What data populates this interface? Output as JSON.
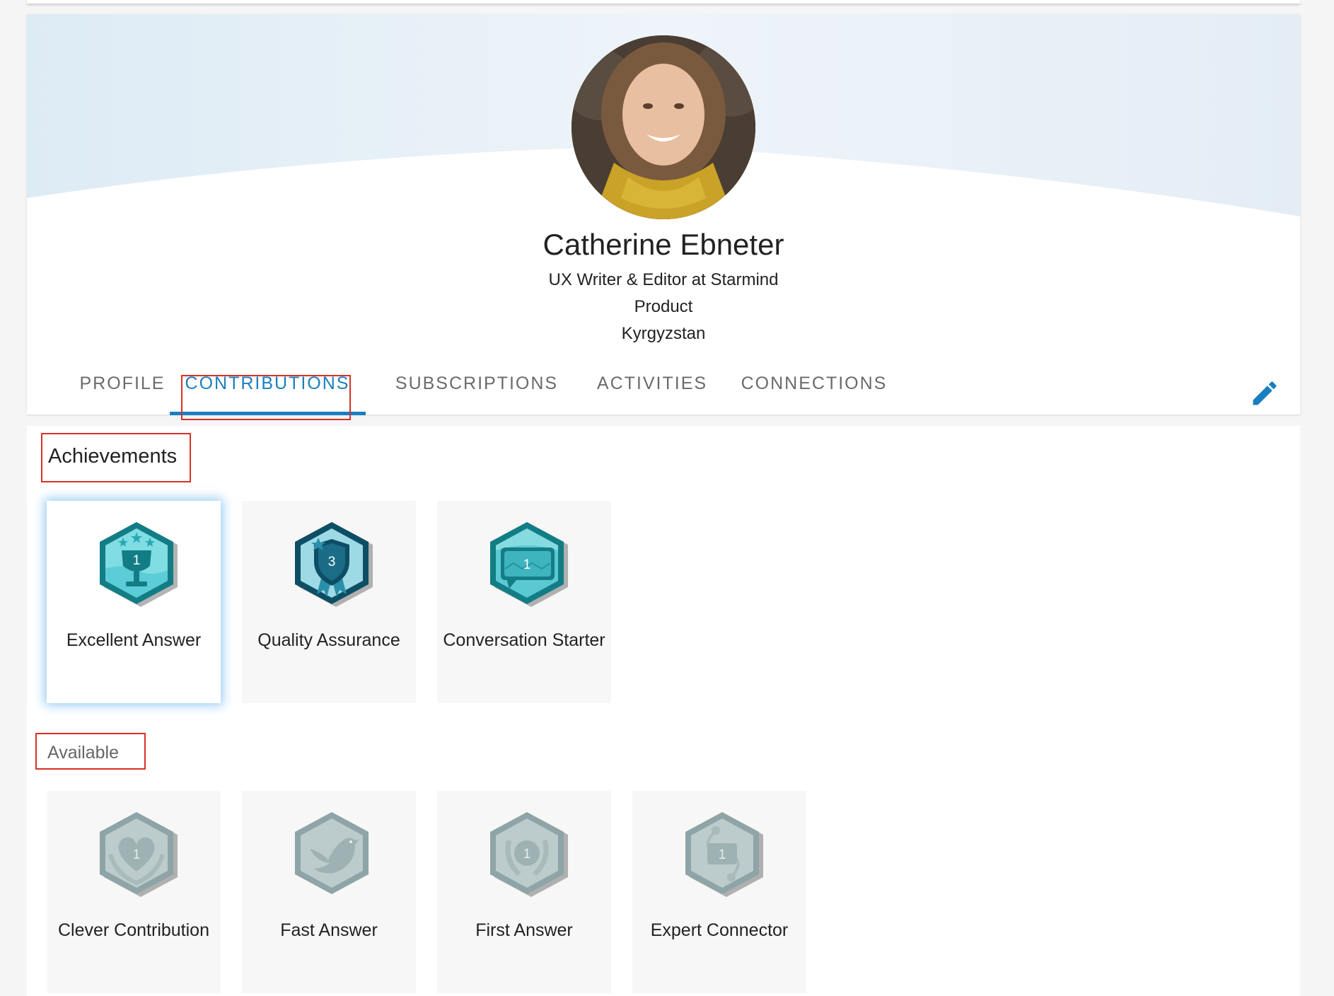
{
  "profile": {
    "name": "Catherine Ebneter",
    "role": "UX Writer & Editor at Starmind",
    "department": "Product",
    "location": "Kyrgyzstan",
    "avatar_alt": "profile photo"
  },
  "tabs": [
    {
      "label": "PROFILE",
      "active": false
    },
    {
      "label": "CONTRIBUTIONS",
      "active": true
    },
    {
      "label": "SUBSCRIPTIONS",
      "active": false
    },
    {
      "label": "ACTIVITIES",
      "active": false
    },
    {
      "label": "CONNECTIONS",
      "active": false
    }
  ],
  "edit_icon": "pencil-icon",
  "achievements": {
    "title": "Achievements",
    "badges": [
      {
        "label": "Excellent Answer",
        "count": "1",
        "icon": "trophy-icon",
        "selected": true
      },
      {
        "label": "Quality Assurance",
        "count": "3",
        "icon": "shield-ribbon-icon",
        "selected": false
      },
      {
        "label": "Conversation Starter",
        "count": "1",
        "icon": "speech-bubble-icon",
        "selected": false
      }
    ]
  },
  "available": {
    "title": "Available",
    "badges": [
      {
        "label": "Clever Contribution",
        "count": "1",
        "icon": "heart-hands-icon"
      },
      {
        "label": "Fast Answer",
        "icon": "bird-icon"
      },
      {
        "label": "First Answer",
        "count": "1",
        "icon": "laurel-medal-icon"
      },
      {
        "label": "Expert Connector",
        "count": "1",
        "icon": "connector-icon"
      }
    ]
  },
  "colors": {
    "accent": "#1a7fc1",
    "highlight_box": "#d93025",
    "badge_teal": "#2bb5bf",
    "badge_dark": "#0e5a72",
    "badge_grey": "#a9bfc0"
  }
}
